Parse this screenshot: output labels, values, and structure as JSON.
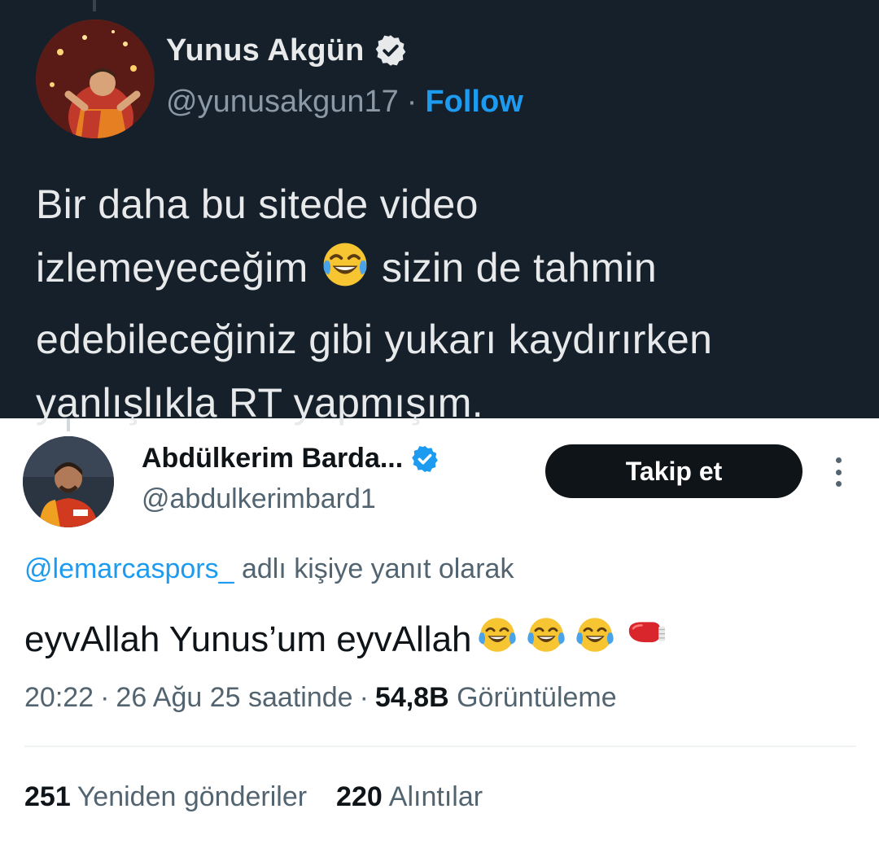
{
  "top_tweet": {
    "display_name": "Yunus Akgün",
    "handle": "@yunusakgun17",
    "separator": "·",
    "follow_label": "Follow",
    "text_line_1": "Bir daha bu sitede video",
    "text_line_2a": "izlemeyeceğim",
    "text_line_2b": "sizin de tahmin",
    "text_line_3": "edebileceğiniz gibi yukarı kaydırırken",
    "text_line_4": "yanlışlıkla RT yapmışım.",
    "emoji": "face-with-tears-of-joy"
  },
  "bottom_tweet": {
    "display_name": "Abdülkerim Barda...",
    "handle": "@abdulkerimbard1",
    "follow_button_label": "Takip et",
    "reply_mention": "@lemarcaspors_",
    "reply_suffix": "adlı kişiye yanıt olarak",
    "text": "eyvAllah Yunus’um eyvAllah",
    "emojis": [
      "face-with-tears-of-joy",
      "face-with-tears-of-joy",
      "face-with-tears-of-joy",
      "boxing-glove"
    ],
    "time": "20:22",
    "separator": "·",
    "date": "26 Ağu 25 saatinde",
    "views_count": "54,8B",
    "views_label": "Görüntüleme",
    "retweets_count": "251",
    "retweets_label": "Yeniden gönderiler",
    "quotes_count": "220",
    "quotes_label": "Alıntılar"
  },
  "colors": {
    "dark_bg": "#15202b",
    "accent_blue": "#1d9bf0",
    "light_text": "#0f1419",
    "muted_text": "#536471"
  }
}
